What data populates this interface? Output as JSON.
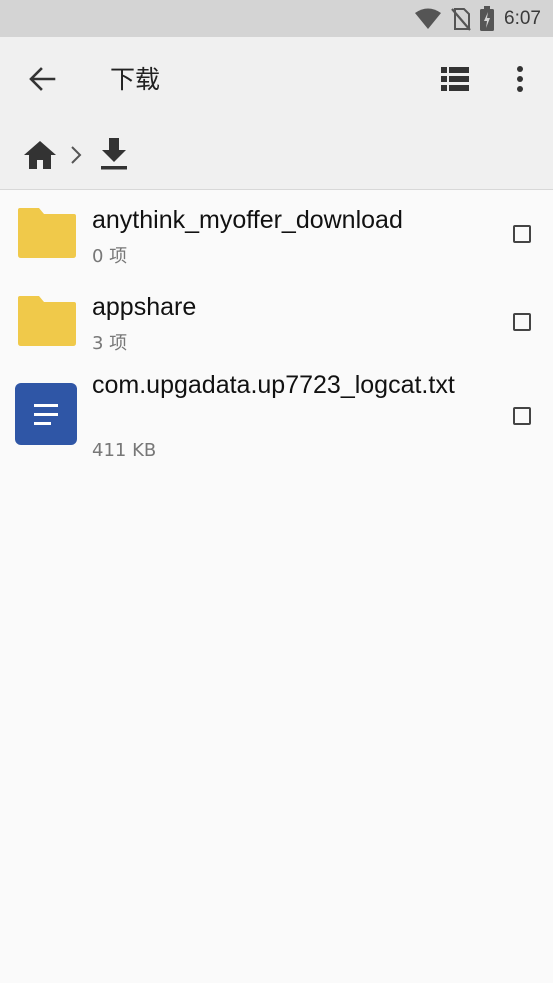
{
  "status_bar": {
    "time": "6:07",
    "icons": [
      "wifi-icon",
      "no-sim-icon",
      "battery-charging-icon"
    ]
  },
  "app_bar": {
    "title": "下载",
    "back_icon": "arrow-back-icon",
    "list_view_icon": "list-view-icon",
    "more_icon": "more-vert-icon"
  },
  "breadcrumb": {
    "items": [
      "home-icon",
      "download-icon"
    ],
    "separator_icon": "chevron-right-icon"
  },
  "files": [
    {
      "type": "folder",
      "icon": "folder-icon",
      "name": "anythink_myoffer_download",
      "meta": "0 项",
      "checked": false
    },
    {
      "type": "folder",
      "icon": "folder-icon",
      "name": "appshare",
      "meta": "3 项",
      "checked": false
    },
    {
      "type": "text",
      "icon": "text-file-icon",
      "name": "com.upgadata.up7723_logcat.txt",
      "meta": "411 KB",
      "checked": false
    }
  ],
  "colors": {
    "status_bar_bg": "#d4d4d4",
    "app_bar_bg": "#f0f0f0",
    "list_bg": "#fafafa",
    "folder": "#f0c94a",
    "text_file": "#2f56a6"
  }
}
